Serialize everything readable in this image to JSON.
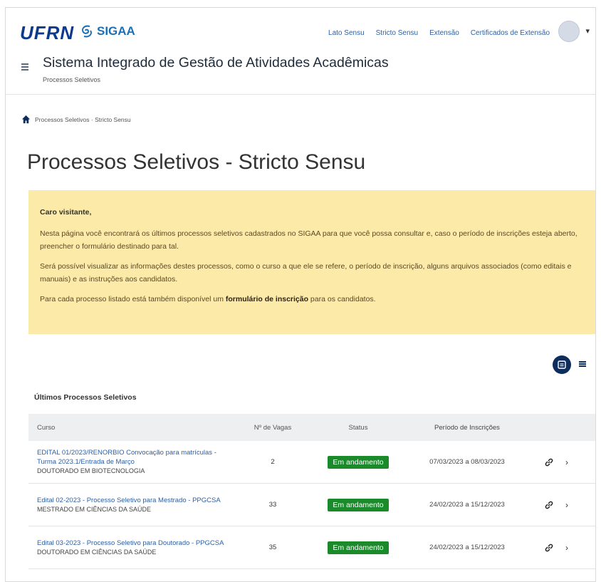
{
  "header": {
    "logo_ufrn": "UFRN",
    "logo_sigaa": "SIGAA",
    "top_links": [
      "Lato Sensu",
      "Stricto Sensu",
      "Extensão",
      "Certificados de Extensão"
    ],
    "system_title": "Sistema Integrado de Gestão de Atividades Acadêmicas",
    "system_subtitle": "Processos Seletivos"
  },
  "breadcrumb": {
    "text": "Processos Seletivos · Stricto Sensu"
  },
  "page_title": "Processos Seletivos - Stricto Sensu",
  "notice": {
    "greeting": "Caro visitante,",
    "p1": "Nesta página você encontrará os últimos processos seletivos cadastrados no SIGAA para que você possa consultar e, caso o período de inscrições esteja aberto, preencher o formulário destinado para tal.",
    "p2": "Será possível visualizar as informações destes processos, como o curso a que ele se refere, o período de inscrição, alguns arquivos associados (como editais e manuais) e as instruções aos candidatos.",
    "p3_before": "Para cada processo listado está também disponível um ",
    "p3_strong": "formulário de inscrição",
    "p3_after": " para os candidatos."
  },
  "list_title": "Últimos Processos Seletivos",
  "table": {
    "headers": {
      "curso": "Curso",
      "vagas": "Nº de Vagas",
      "status": "Status",
      "periodo": "Período de Inscrições"
    },
    "rows": [
      {
        "edital": "EDITAL 01/2023/RENORBIO Convocação para matrículas - Turma 2023.1/Entrada de Março",
        "curso": "DOUTORADO EM BIOTECNOLOGIA",
        "vagas": "2",
        "status": "Em andamento",
        "periodo": "07/03/2023 a 08/03/2023"
      },
      {
        "edital": "Edital 02-2023 - Processo Seletivo para Mestrado - PPGCSA",
        "curso": "MESTRADO EM CIÊNCIAS DA SAÚDE",
        "vagas": "33",
        "status": "Em andamento",
        "periodo": "24/02/2023 a 15/12/2023"
      },
      {
        "edital": "Edital 03-2023 - Processo Seletivo para Doutorado - PPGCSA",
        "curso": "DOUTORADO EM CIÊNCIAS DA SAÚDE",
        "vagas": "35",
        "status": "Em andamento",
        "periodo": "24/02/2023 a 15/12/2023"
      }
    ]
  },
  "colors": {
    "notice_bg": "#fbeaa8",
    "badge": "#1a8a2a",
    "link": "#2d5fa5",
    "brand": "#0d3b8c"
  }
}
